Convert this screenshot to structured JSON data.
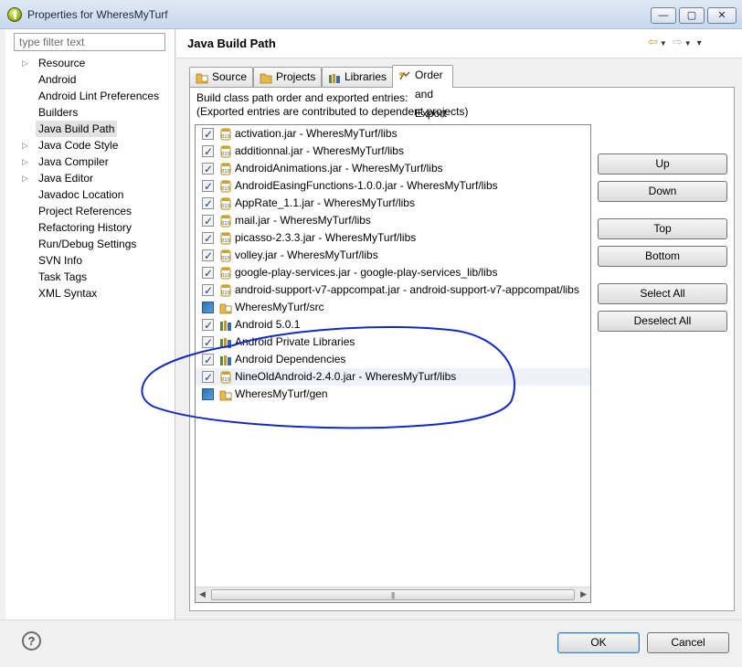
{
  "window": {
    "title": "Properties for WheresMyTurf",
    "min_glyph": "—",
    "max_glyph": "▢",
    "close_glyph": "✕"
  },
  "sidebar": {
    "filter_placeholder": "type filter text",
    "items": [
      {
        "label": "Resource",
        "expandable": true
      },
      {
        "label": "Android",
        "expandable": false
      },
      {
        "label": "Android Lint Preferences",
        "expandable": false
      },
      {
        "label": "Builders",
        "expandable": false
      },
      {
        "label": "Java Build Path",
        "expandable": false,
        "selected": true
      },
      {
        "label": "Java Code Style",
        "expandable": true
      },
      {
        "label": "Java Compiler",
        "expandable": true
      },
      {
        "label": "Java Editor",
        "expandable": true
      },
      {
        "label": "Javadoc Location",
        "expandable": false
      },
      {
        "label": "Project References",
        "expandable": false
      },
      {
        "label": "Refactoring History",
        "expandable": false
      },
      {
        "label": "Run/Debug Settings",
        "expandable": false
      },
      {
        "label": "SVN Info",
        "expandable": false
      },
      {
        "label": "Task Tags",
        "expandable": false
      },
      {
        "label": "XML Syntax",
        "expandable": false
      }
    ]
  },
  "page": {
    "title": "Java Build Path",
    "tabs": [
      {
        "label": "Source",
        "icon": "source-folder-icon"
      },
      {
        "label": "Projects",
        "icon": "projects-icon"
      },
      {
        "label": "Libraries",
        "icon": "libraries-icon"
      },
      {
        "label": "Order and Export",
        "icon": "order-export-icon",
        "active": true
      }
    ],
    "description_line1": "Build class path order and exported entries:",
    "description_line2": "(Exported entries are contributed to dependent projects)"
  },
  "entries": [
    {
      "label": "activation.jar - WheresMyTurf/libs",
      "icon": "jar-icon",
      "check": "checked"
    },
    {
      "label": "additionnal.jar - WheresMyTurf/libs",
      "icon": "jar-icon",
      "check": "checked"
    },
    {
      "label": "AndroidAnimations.jar - WheresMyTurf/libs",
      "icon": "jar-icon",
      "check": "checked"
    },
    {
      "label": "AndroidEasingFunctions-1.0.0.jar - WheresMyTurf/libs",
      "icon": "jar-icon",
      "check": "checked"
    },
    {
      "label": "AppRate_1.1.jar - WheresMyTurf/libs",
      "icon": "jar-icon",
      "check": "checked"
    },
    {
      "label": "mail.jar - WheresMyTurf/libs",
      "icon": "jar-icon",
      "check": "checked"
    },
    {
      "label": "picasso-2.3.3.jar - WheresMyTurf/libs",
      "icon": "jar-icon",
      "check": "checked"
    },
    {
      "label": "volley.jar - WheresMyTurf/libs",
      "icon": "jar-icon",
      "check": "checked"
    },
    {
      "label": "google-play-services.jar - google-play-services_lib/libs",
      "icon": "jar-icon",
      "check": "checked"
    },
    {
      "label": "android-support-v7-appcompat.jar - android-support-v7-appcompat/libs",
      "icon": "jar-icon",
      "check": "checked"
    },
    {
      "label": "WheresMyTurf/src",
      "icon": "source-folder-icon",
      "check": "solid"
    },
    {
      "label": "Android 5.0.1",
      "icon": "library-container-icon",
      "check": "checked"
    },
    {
      "label": "Android Private Libraries",
      "icon": "library-container-icon",
      "check": "checked"
    },
    {
      "label": "Android Dependencies",
      "icon": "library-container-icon",
      "check": "checked"
    },
    {
      "label": "NineOldAndroid-2.4.0.jar - WheresMyTurf/libs",
      "icon": "jar-icon",
      "check": "checked",
      "highlight": true
    },
    {
      "label": "WheresMyTurf/gen",
      "icon": "source-folder-icon",
      "check": "solid"
    }
  ],
  "buttons": {
    "up": "Up",
    "down": "Down",
    "top": "Top",
    "bottom": "Bottom",
    "select_all": "Select All",
    "deselect_all": "Deselect All"
  },
  "scrollbar_grip": "|||",
  "footer": {
    "help_glyph": "?",
    "ok": "OK",
    "cancel": "Cancel"
  },
  "colors": {
    "annotation_stroke": "#1428c8",
    "checkmark": "#1c3f8a",
    "jar_icon": "#c8a431",
    "folder_icon": "#e7b94b"
  }
}
